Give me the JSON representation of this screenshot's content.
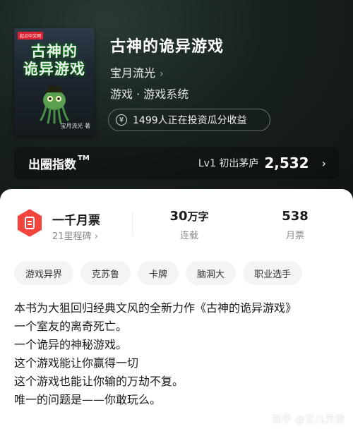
{
  "book": {
    "title": "古神的诡异游戏",
    "author": "宝月流光",
    "genre": "游戏 · 游戏系统",
    "cover_title_lines": [
      "古神的",
      "诡异游戏"
    ],
    "cover_publisher": "起点中文网",
    "cover_author": "宝月流光 著"
  },
  "invest": {
    "icon": "yen-circle-icon",
    "label": "1499人正在投资瓜分收益"
  },
  "index": {
    "label": "出圈指数",
    "tm": "TM",
    "level": "Lv1 初出茅庐",
    "value": "2,532"
  },
  "monthly": {
    "title": "一千月票",
    "subtitle": "21里程碑",
    "badge_color": "#f2453d"
  },
  "stats": [
    {
      "number": "30",
      "unit": "万字",
      "label": "连载"
    },
    {
      "number": "538",
      "unit": "",
      "label": "月票"
    }
  ],
  "tags": [
    "游戏异界",
    "克苏鲁",
    "卡牌",
    "脑洞大",
    "职业选手"
  ],
  "description": [
    "本书为大狙回归经典文风的全新力作《古神的诡异游戏》",
    "一个室友的离奇死亡。",
    "一个诡异的神秘游戏。",
    "这个游戏能让你赢得一切",
    "这个游戏也能让你输的万劫不复。",
    "唯一的问题是——你敢玩么。"
  ],
  "watermark": "知乎 @艾儿天空"
}
